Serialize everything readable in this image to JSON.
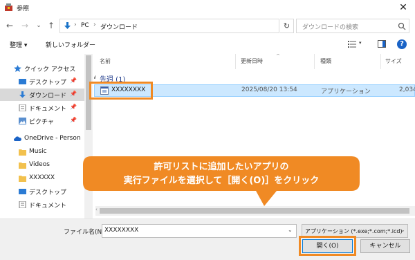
{
  "window": {
    "title": "参照",
    "close_glyph": "✕"
  },
  "nav": {
    "back_glyph": "←",
    "forward_glyph": "→",
    "history_glyph": "⌄",
    "up_glyph": "↑",
    "breadcrumb": [
      "PC",
      "ダウンロード"
    ],
    "separator": "›",
    "refresh_glyph": "↻",
    "search_placeholder": "ダウンロードの検索"
  },
  "toolbar": {
    "organize": "整理 ▾",
    "new_folder": "新しいフォルダー",
    "view_dropdown_glyph": "▾",
    "help_glyph": "?"
  },
  "sidebar": {
    "pin_glyph": "📌",
    "items": [
      {
        "label": "クイック アクセス",
        "icon": "star-icon"
      },
      {
        "label": "デスクトップ",
        "icon": "desktop-icon",
        "pinned": true
      },
      {
        "label": "ダウンロード",
        "icon": "download-icon",
        "pinned": true,
        "selected": true
      },
      {
        "label": "ドキュメント",
        "icon": "document-icon",
        "pinned": true
      },
      {
        "label": "ピクチャ",
        "icon": "picture-icon",
        "pinned": true
      },
      {
        "label": "OneDrive - Person",
        "icon": "cloud-icon"
      },
      {
        "label": "Music",
        "icon": "folder-icon"
      },
      {
        "label": "Videos",
        "icon": "folder-icon"
      },
      {
        "label": "XXXXXX",
        "icon": "folder-icon"
      },
      {
        "label": "デスクトップ",
        "icon": "desktop-icon"
      },
      {
        "label": "ドキュメント",
        "icon": "document-icon"
      }
    ]
  },
  "file_list": {
    "columns": [
      "名前",
      "更新日時",
      "種類",
      "サイズ"
    ],
    "sort_glyph": "^",
    "group_caret": "∨",
    "group_label": "先週 (1)",
    "rows": [
      {
        "name": "XXXXXXXX",
        "modified": "2025/08/20 13:54",
        "type": "アプリケーション",
        "size": "2,034"
      }
    ],
    "scroll_left_glyph": "‹"
  },
  "bottom": {
    "filename_label": "ファイル名(N):",
    "filename_value": "XXXXXXXX",
    "filter_value": "アプリケーション (*.exe;*.com;*.icd)",
    "dropdown_glyph": "⌄",
    "open_button": "開く(O)",
    "cancel_button": "キャンセル"
  },
  "callout": {
    "line1": "許可リストに追加したいアプリの",
    "line2": "実行ファイルを選択して［開く(O)］をクリック"
  },
  "colors": {
    "accent": "#f08a24",
    "selection": "#cce8ff",
    "balloon": "#f08a24"
  }
}
